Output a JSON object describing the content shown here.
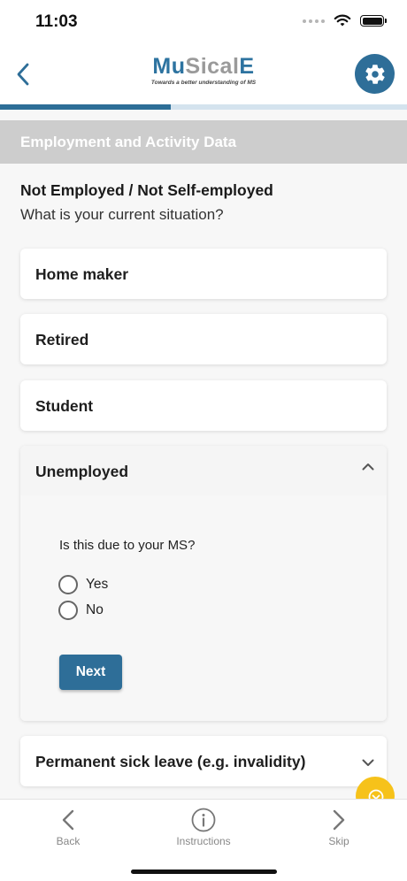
{
  "status_bar": {
    "time": "11:03"
  },
  "header": {
    "logo_part1": "Mu",
    "logo_part2": "Sical",
    "logo_part3": "E",
    "logo_tagline": "Towards a better understanding of MS"
  },
  "progress": {
    "fraction": 0.42,
    "fill_color": "#2d6e97",
    "track_color": "#d4e3ee"
  },
  "section": {
    "title": "Employment and Activity Data"
  },
  "question": {
    "heading": "Not Employed / Not Self-employed",
    "prompt": "What is your current situation?"
  },
  "options": [
    {
      "label": "Home maker"
    },
    {
      "label": "Retired"
    },
    {
      "label": "Student"
    },
    {
      "label": "Unemployed",
      "expanded": true
    },
    {
      "label": "Permanent sick leave (e.g. invalidity)"
    }
  ],
  "followup": {
    "question": "Is this due to your MS?",
    "choices": [
      "Yes",
      "No"
    ],
    "next_label": "Next"
  },
  "bottom_nav": {
    "back_label": "Back",
    "instructions_label": "Instructions",
    "skip_label": "Skip"
  },
  "colors": {
    "primary": "#2e6e98",
    "fab": "#f6c21a",
    "section_band": "#cdcdcd"
  },
  "icons": [
    "back-chevron-icon",
    "gear-icon",
    "chevron-up-icon",
    "chevron-down-icon",
    "info-icon",
    "chevron-left-icon",
    "chevron-right-icon",
    "wifi-icon",
    "battery-icon",
    "help-icon"
  ]
}
